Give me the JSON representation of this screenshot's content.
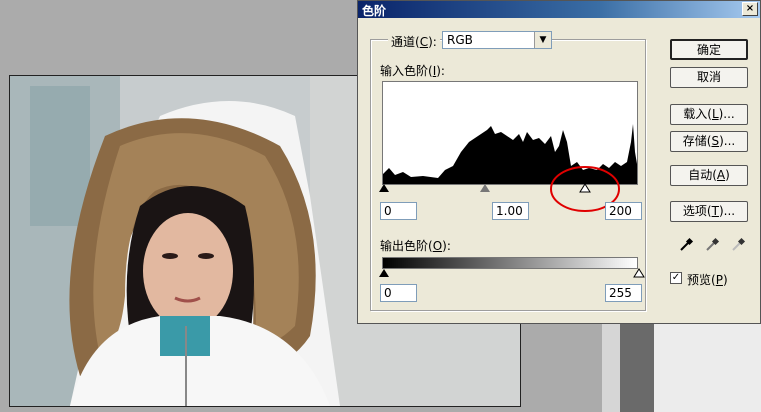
{
  "dialog": {
    "title": "色阶",
    "close_glyph": "×"
  },
  "channel": {
    "label_prefix": "通道(",
    "label_key": "C",
    "label_suffix": "):",
    "value": "RGB"
  },
  "input_levels": {
    "label_prefix": "输入色阶(",
    "label_key": "I",
    "label_suffix": "):",
    "black": "0",
    "gamma": "1.00",
    "white": "200"
  },
  "output_levels": {
    "label_prefix": "输出色阶(",
    "label_key": "O",
    "label_suffix": "):",
    "black": "0",
    "white": "255"
  },
  "buttons": {
    "ok": "确定",
    "cancel": "取消",
    "load_prefix": "载入(",
    "load_key": "L",
    "load_suffix": ")...",
    "save_prefix": "存储(",
    "save_key": "S",
    "save_suffix": ")...",
    "auto_prefix": "自动(",
    "auto_key": "A",
    "auto_suffix": ")",
    "options_prefix": "选项(",
    "options_key": "T",
    "options_suffix": ")..."
  },
  "preview": {
    "label_prefix": "预览(",
    "label_key": "P",
    "label_suffix": ")",
    "checked_glyph": "✓"
  },
  "colors": {
    "annotation_circle": "#e00000",
    "titlebar": "#0a246a"
  }
}
